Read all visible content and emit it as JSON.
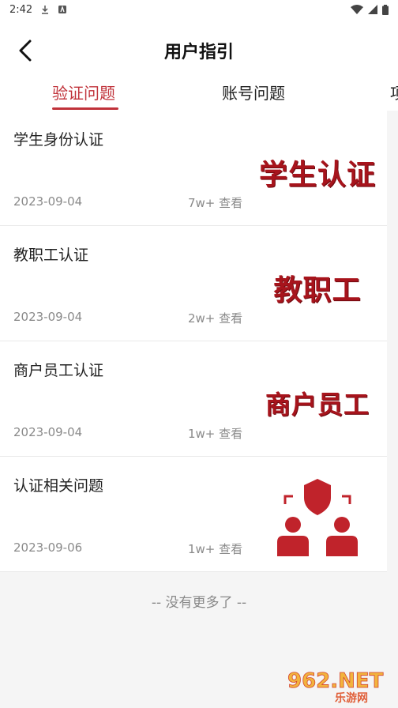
{
  "status_bar": {
    "time": "2:42"
  },
  "header": {
    "title": "用户指引"
  },
  "tabs": [
    {
      "label": "验证问题",
      "active": true
    },
    {
      "label": "账号问题",
      "active": false
    },
    {
      "label": "项",
      "active": false
    }
  ],
  "items": [
    {
      "title": "学生身份认证",
      "date": "2023-09-04",
      "views": "7w+ 查看",
      "thumb_text": "学生认证"
    },
    {
      "title": "教职工认证",
      "date": "2023-09-04",
      "views": "2w+ 查看",
      "thumb_text": "教职工"
    },
    {
      "title": "商户员工认证",
      "date": "2023-09-04",
      "views": "1w+ 查看",
      "thumb_text": "商户员工"
    },
    {
      "title": "认证相关问题",
      "date": "2023-09-06",
      "views": "1w+ 查看",
      "thumb_icon": "user-shield-icon"
    }
  ],
  "end_note": "-- 没有更多了 --",
  "watermark": {
    "brand": "962.NET",
    "sub": "乐游网"
  },
  "colors": {
    "accent": "#c0323a",
    "thumb_red": "#a7141c"
  }
}
